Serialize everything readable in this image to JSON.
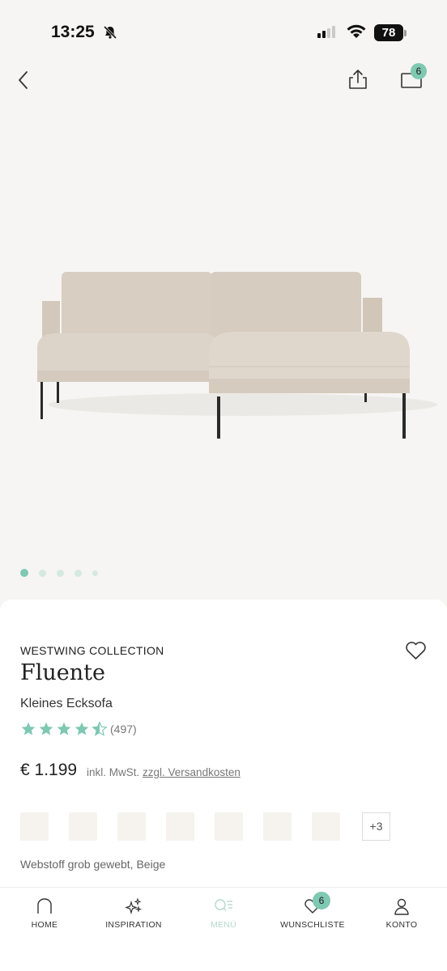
{
  "status_bar": {
    "time": "13:25",
    "battery": "78"
  },
  "header": {
    "cart_count": "6"
  },
  "carousel": {
    "total": 5,
    "active": 0
  },
  "product": {
    "brand": "WESTWING COLLECTION",
    "name": "Fluente",
    "subtitle": "Kleines Ecksofa",
    "rating_value": 4.5,
    "rating_max": 5,
    "rating_count": "(497)",
    "price": "€ 1.199",
    "tax_note": "inkl. MwSt.",
    "shipping_link": "zzgl. Versandkosten",
    "more_swatches": "+3",
    "fabric": "Webstoff grob gewebt, Beige"
  },
  "colors": {
    "accent": "#7fc8b2",
    "star": "#7fc8b2",
    "sofa": "#d9cfc3"
  },
  "bottom_nav": {
    "items": [
      {
        "label": "HOME",
        "icon": "home-icon"
      },
      {
        "label": "INSPIRATION",
        "icon": "sparkles-icon"
      },
      {
        "label": "MENÜ",
        "icon": "menu-search-icon"
      },
      {
        "label": "WUNSCHLISTE",
        "icon": "heart-icon"
      },
      {
        "label": "KONTO",
        "icon": "user-icon"
      }
    ],
    "active": "MENÜ",
    "wishlist_count": "6"
  }
}
